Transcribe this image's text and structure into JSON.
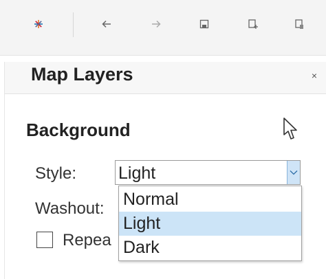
{
  "toolbar": {
    "buttons": [
      {
        "icon": "tableau-logo-icon"
      },
      {
        "icon": "undo-arrow-icon"
      },
      {
        "icon": "redo-arrow-icon"
      },
      {
        "icon": "save-icon"
      },
      {
        "icon": "new-data-source-icon"
      },
      {
        "icon": "pause-updates-icon"
      }
    ]
  },
  "panel": {
    "title": "Map Layers",
    "close_label": "×",
    "section_title": "Background",
    "style_label": "Style:",
    "style_value": "Light",
    "washout_label": "Washout:",
    "repeat_label": "Repea",
    "repeat_checked": false,
    "style_options": [
      {
        "label": "Normal",
        "selected": false
      },
      {
        "label": "Light",
        "selected": true
      },
      {
        "label": "Dark",
        "selected": false
      }
    ]
  },
  "colors": {
    "selection": "#cce4f7",
    "accent": "#88b4db"
  }
}
